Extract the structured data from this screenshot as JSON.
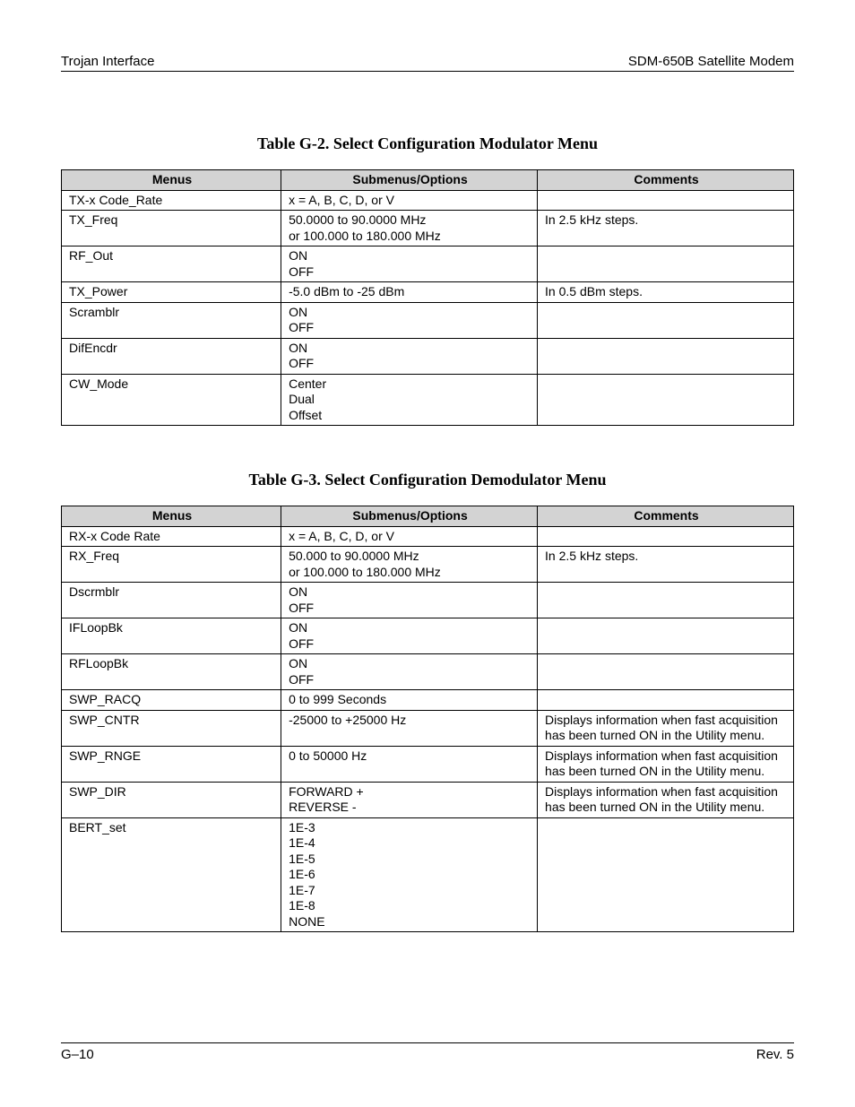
{
  "header": {
    "left": "Trojan Interface",
    "right": "SDM-650B Satellite Modem"
  },
  "footer": {
    "left": "G–10",
    "right": "Rev. 5"
  },
  "columns": {
    "menus": "Menus",
    "submenus": "Submenus/Options",
    "comments": "Comments"
  },
  "table1": {
    "caption": "Table G-2.  Select Configuration Modulator Menu",
    "rows": [
      {
        "menu": "TX-x Code_Rate",
        "sub": "x = A, B, C, D, or V",
        "comment": ""
      },
      {
        "menu": "TX_Freq",
        "sub": "50.0000 to 90.0000 MHz\nor 100.000 to 180.000 MHz",
        "comment": "In 2.5 kHz steps."
      },
      {
        "menu": "RF_Out",
        "sub": "ON\nOFF",
        "comment": ""
      },
      {
        "menu": "TX_Power",
        "sub": "-5.0 dBm to -25 dBm",
        "comment": "In 0.5 dBm steps."
      },
      {
        "menu": "Scramblr",
        "sub": "ON\nOFF",
        "comment": ""
      },
      {
        "menu": "DifEncdr",
        "sub": "ON\nOFF",
        "comment": ""
      },
      {
        "menu": "CW_Mode",
        "sub": "Center\nDual\nOffset",
        "comment": ""
      }
    ]
  },
  "table2": {
    "caption": "Table G-3.  Select Configuration Demodulator Menu",
    "rows": [
      {
        "menu": "RX-x Code Rate",
        "sub": "x = A, B, C, D, or V",
        "comment": ""
      },
      {
        "menu": "RX_Freq",
        "sub": "50.000 to 90.0000 MHz\nor 100.000 to 180.000 MHz",
        "comment": "In 2.5 kHz steps."
      },
      {
        "menu": "Dscrmblr",
        "sub": "ON\nOFF",
        "comment": ""
      },
      {
        "menu": "IFLoopBk",
        "sub": "ON\nOFF",
        "comment": ""
      },
      {
        "menu": "RFLoopBk",
        "sub": "ON\nOFF",
        "comment": ""
      },
      {
        "menu": "SWP_RACQ",
        "sub": "0 to 999 Seconds",
        "comment": ""
      },
      {
        "menu": "SWP_CNTR",
        "sub": "-25000 to +25000 Hz",
        "comment": "Displays information when fast acquisition has been turned ON in the Utility menu."
      },
      {
        "menu": "SWP_RNGE",
        "sub": "0 to 50000 Hz",
        "comment": "Displays information when fast acquisition has been turned ON in the Utility menu."
      },
      {
        "menu": "SWP_DIR",
        "sub": "FORWARD +\nREVERSE -",
        "comment": "Displays information when fast acquisition has been turned ON in the Utility menu."
      },
      {
        "menu": "BERT_set",
        "sub": "1E-3\n1E-4\n1E-5\n1E-6\n1E-7\n1E-8\nNONE",
        "comment": ""
      }
    ]
  }
}
